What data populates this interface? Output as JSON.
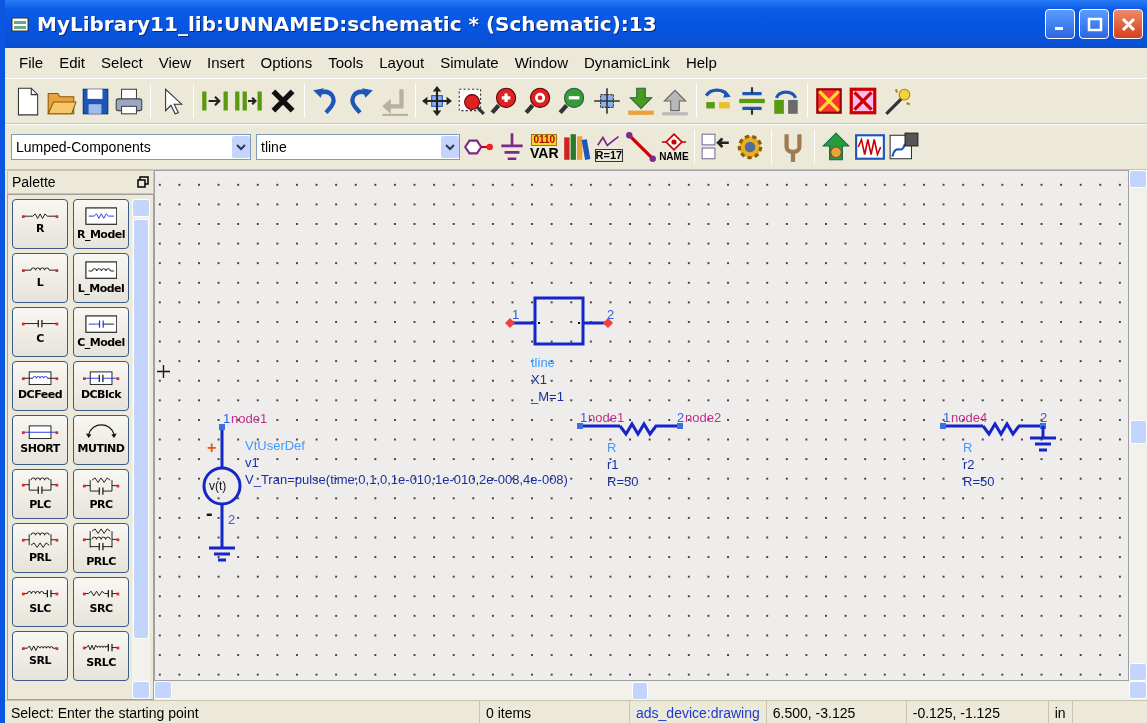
{
  "window": {
    "title": "MyLibrary11_lib:UNNAMED:schematic * (Schematic):13"
  },
  "menu": [
    {
      "label": "File"
    },
    {
      "label": "Edit"
    },
    {
      "label": "Select"
    },
    {
      "label": "View"
    },
    {
      "label": "Insert"
    },
    {
      "label": "Options"
    },
    {
      "label": "Tools"
    },
    {
      "label": "Layout"
    },
    {
      "label": "Simulate"
    },
    {
      "label": "Window"
    },
    {
      "label": "DynamicLink"
    },
    {
      "label": "Help"
    }
  ],
  "main_toolbar": [
    {
      "kind": "new"
    },
    {
      "kind": "open"
    },
    {
      "kind": "save"
    },
    {
      "kind": "print"
    },
    {
      "kind": "sep"
    },
    {
      "kind": "select"
    },
    {
      "kind": "sep"
    },
    {
      "kind": "pin"
    },
    {
      "kind": "wires"
    },
    {
      "kind": "delete"
    },
    {
      "kind": "sep"
    },
    {
      "kind": "undo"
    },
    {
      "kind": "redo"
    },
    {
      "kind": "back"
    },
    {
      "kind": "sep"
    },
    {
      "kind": "fit"
    },
    {
      "kind": "zoomarea"
    },
    {
      "kind": "zoomin"
    },
    {
      "kind": "zoom2"
    },
    {
      "kind": "zoomout"
    },
    {
      "kind": "snap"
    },
    {
      "kind": "push"
    },
    {
      "kind": "pop"
    },
    {
      "kind": "sep"
    },
    {
      "kind": "swap"
    },
    {
      "kind": "split"
    },
    {
      "kind": "flip"
    },
    {
      "kind": "sep"
    },
    {
      "kind": "crossbox"
    },
    {
      "kind": "crossbox2"
    },
    {
      "kind": "wand"
    }
  ],
  "component_toolbar": {
    "library": "Lumped-Components",
    "component": "tline",
    "items": [
      {
        "kind": "port"
      },
      {
        "kind": "ground"
      },
      {
        "kind": "var",
        "texts": [
          "0110",
          "VAR"
        ]
      },
      {
        "kind": "books"
      },
      {
        "kind": "sweep",
        "texts": [
          "R=17"
        ]
      },
      {
        "kind": "wire"
      },
      {
        "kind": "name",
        "texts": [
          "NAME"
        ]
      },
      {
        "kind": "sep"
      },
      {
        "kind": "arrowlist"
      },
      {
        "kind": "gear"
      },
      {
        "kind": "sep"
      },
      {
        "kind": "fork"
      },
      {
        "kind": "sep"
      },
      {
        "kind": "simulate"
      },
      {
        "kind": "waveform"
      },
      {
        "kind": "display"
      }
    ]
  },
  "palette": {
    "title": "Palette",
    "items": [
      {
        "label": "R",
        "kind": "r"
      },
      {
        "label": "R_Model",
        "kind": "r_model"
      },
      {
        "label": "L",
        "kind": "l"
      },
      {
        "label": "L_Model",
        "kind": "l_model"
      },
      {
        "label": "C",
        "kind": "c"
      },
      {
        "label": "C_Model",
        "kind": "c_model"
      },
      {
        "label": "DCFeed",
        "kind": "dcfeed"
      },
      {
        "label": "DCBlck",
        "kind": "dcblock"
      },
      {
        "label": "SHORT",
        "kind": "short"
      },
      {
        "label": "MUTIND",
        "kind": "mutind"
      },
      {
        "label": "PLC",
        "kind": "plc"
      },
      {
        "label": "PRC",
        "kind": "prc"
      },
      {
        "label": "PRL",
        "kind": "prl"
      },
      {
        "label": "PRLC",
        "kind": "prlc"
      },
      {
        "label": "SLC",
        "kind": "slc"
      },
      {
        "label": "SRC",
        "kind": "src"
      },
      {
        "label": "SRL",
        "kind": "srl"
      },
      {
        "label": "SRLC",
        "kind": "srlc"
      }
    ]
  },
  "schematic": {
    "components": [
      {
        "kind": "tline",
        "grounded": false,
        "labels": [
          "tline",
          "X1",
          "_M=1"
        ],
        "pins": [
          {
            "number": "1"
          },
          {
            "number": "2"
          }
        ]
      },
      {
        "kind": "vsource",
        "grounded": true,
        "symbol": "v(t)",
        "polarity": [
          "+",
          "-"
        ],
        "labels": [
          "VtUserDef",
          "v1",
          "V_Tran=pulse(time,0,1,0,1e-010,1e-010,2e-008,4e-008)"
        ],
        "pins": [
          {
            "number": "1",
            "net": "node1"
          },
          {
            "number": "2"
          }
        ]
      },
      {
        "kind": "resistor",
        "grounded": false,
        "labels": [
          "R",
          "r1",
          "R=50"
        ],
        "pins": [
          {
            "number": "1",
            "net": "node1"
          },
          {
            "number": "2",
            "net": "node2"
          }
        ]
      },
      {
        "kind": "resistor",
        "grounded": true,
        "labels": [
          "R",
          "r2",
          "R=50"
        ],
        "pins": [
          {
            "number": "1",
            "net": "node4"
          },
          {
            "number": "2"
          }
        ]
      }
    ]
  },
  "status_bar": {
    "prompt": "Select: Enter the starting point",
    "items": "0 items",
    "layer": "ads_device:drawing",
    "coordinates": "6.500, -3.125",
    "delta": "-0.125, -1.125",
    "units": "in"
  }
}
